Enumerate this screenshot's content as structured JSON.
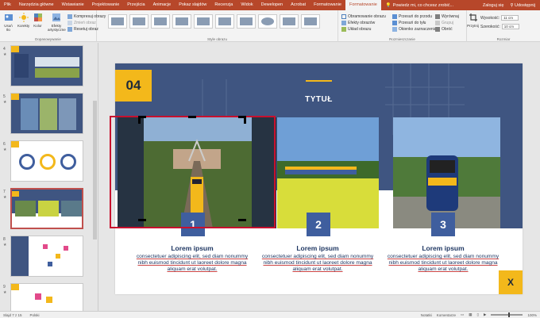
{
  "tabs": {
    "items": [
      "Plik",
      "Narzędzia główne",
      "Wstawianie",
      "Projektowanie",
      "Przejścia",
      "Animacje",
      "Pokaz slajdów",
      "Recenzja",
      "Widok",
      "Dewelopen",
      "Acrobat",
      "Formatowanie",
      "Formatowanie"
    ],
    "active_index": 12,
    "tell_me": "Powiedz mi, co chcesz zrobić...",
    "sign_in": "Zaloguj się",
    "share": "Udostępnij"
  },
  "ribbon": {
    "remove_bg": "Usuń tło",
    "corrections": "Korekty",
    "color": "Kolor",
    "artistic": "Efekty artystyczne",
    "compress": "Kompresuj obrazy",
    "change_picture": "Zmień obraz",
    "reset_picture": "Resetuj obraz",
    "adjust_label": "Dopasowywanie",
    "styles_label": "Style obrazu",
    "border": "Obramowanie obrazu",
    "effects": "Efekty obrazów",
    "layout": "Układ obrazu",
    "forward": "Przesuń do przodu",
    "backward": "Przesuń do tyłu",
    "selection_pane": "Okienko zaznaczenia",
    "align": "Wyrównaj",
    "group": "Grupuj",
    "rotate": "Obróć",
    "arrange_label": "Rozmieszczanie",
    "crop": "Przytnij",
    "height_label": "Wysokość:",
    "height_value": "11 cm",
    "width_label": "Szerokość:",
    "width_value": "10 cm",
    "size_label": "Rozmiar"
  },
  "thumbnails": [
    {
      "num": "4",
      "star": "★"
    },
    {
      "num": "5",
      "star": "★"
    },
    {
      "num": "6",
      "star": "★"
    },
    {
      "num": "7",
      "star": "★"
    },
    {
      "num": "8",
      "star": "★"
    },
    {
      "num": "9",
      "star": "★"
    }
  ],
  "slide": {
    "badge": "04",
    "title": "TYTUŁ",
    "columns": [
      {
        "number": "1",
        "heading": "Lorem ipsum",
        "text": "consectetuer adipiscing elit, sed diam nonummy nibh euismod tincidunt ut laoreet dolore magna aliquam erat volutpat."
      },
      {
        "number": "2",
        "heading": "Lorem ipsum",
        "text": "consectetuer adipiscing elit, sed diam nonummy nibh euismod tincidunt ut laoreet dolore magna aliquam erat volutpat."
      },
      {
        "number": "3",
        "heading": "Lorem ipsum",
        "text": "consectetuer adipiscing elit, sed diam nonummy nibh euismod tincidunt ut laoreet dolore magna aliquam erat volutpat."
      }
    ],
    "corner": "X"
  },
  "status": {
    "slide_info": "Slajd 7 z 15",
    "language": "Polski",
    "notes": "Notatki",
    "comments": "Komentarze",
    "zoom": "100%"
  },
  "colors": {
    "accent": "#b7472a",
    "slide_blue": "#3f5581",
    "yellow": "#f3b81b",
    "number_blue": "#3f5e9e"
  }
}
